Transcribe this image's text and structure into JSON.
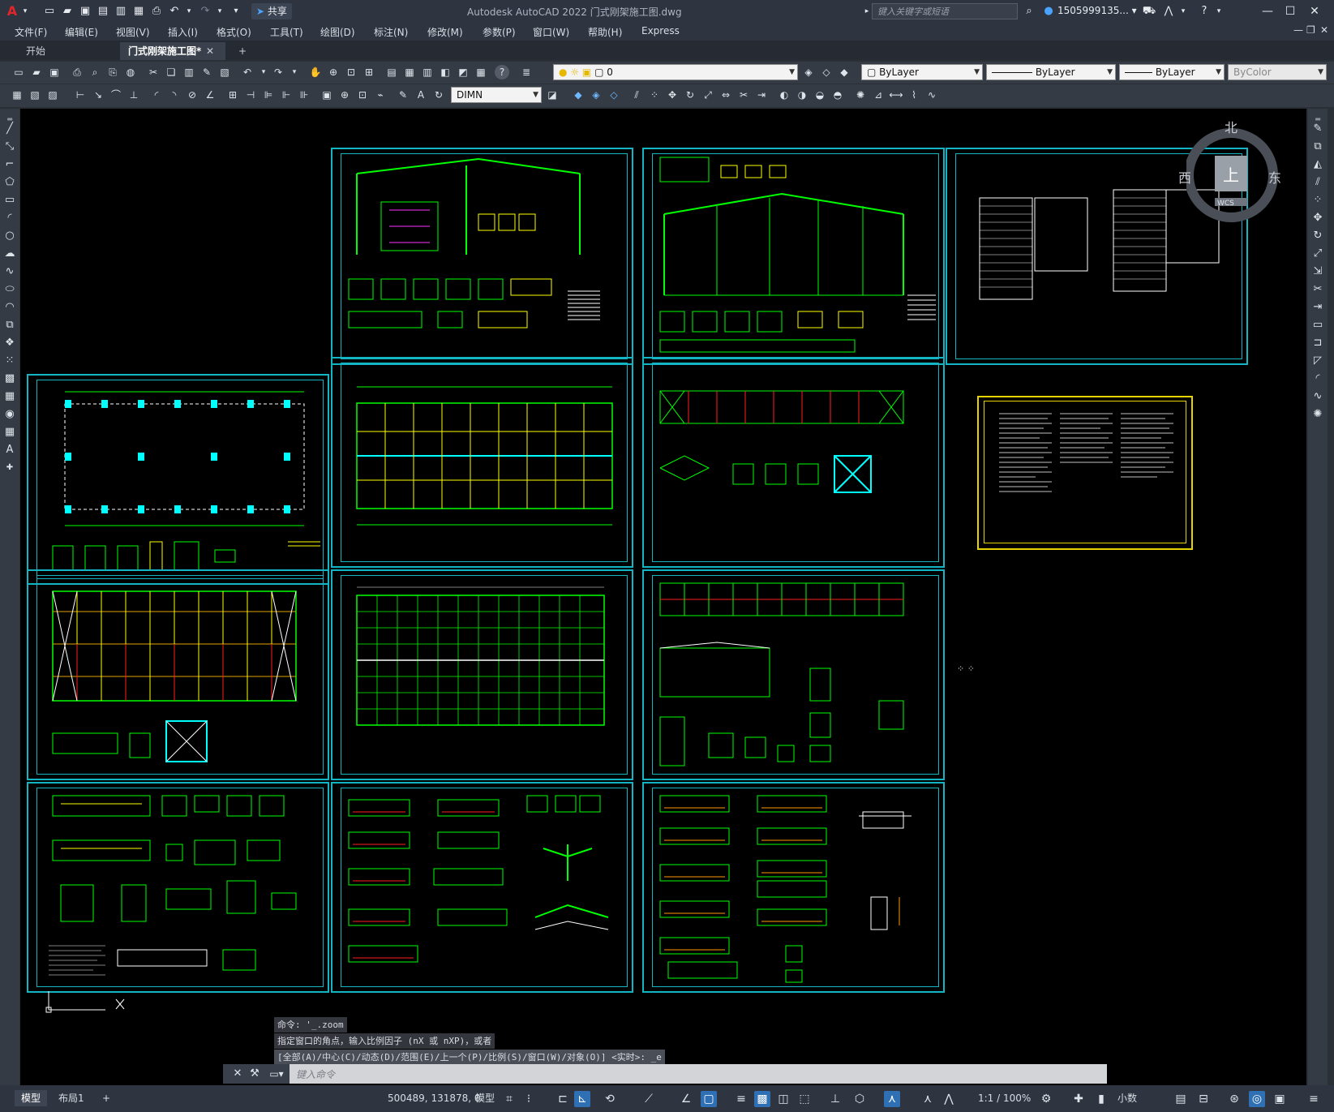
{
  "app": {
    "title": "Autodesk AutoCAD 2022    门式刚架施工图.dwg",
    "logo": "A",
    "share_label": "共享",
    "search_placeholder": "键入关键字或短语",
    "user": "1505999135... ▾"
  },
  "menu": [
    "文件(F)",
    "编辑(E)",
    "视图(V)",
    "插入(I)",
    "格式(O)",
    "工具(T)",
    "绘图(D)",
    "标注(N)",
    "修改(M)",
    "参数(P)",
    "窗口(W)",
    "帮助(H)",
    "Express"
  ],
  "tabs": {
    "start": "开始",
    "drawing": "门式刚架施工图*",
    "add": "+"
  },
  "toolbar": {
    "layer_value": "0",
    "color_value": "ByLayer",
    "linetype_value": "ByLayer",
    "lineweight_value": "ByLayer",
    "plotstyle_value": "ByColor",
    "dimstyle_value": "DIMN"
  },
  "compass": {
    "north": "北",
    "west": "西",
    "east": "东",
    "top": "上",
    "wcs": "WCS"
  },
  "command": {
    "history": [
      "命令: '_.zoom",
      "指定窗口的角点，输入比例因子 (nX 或 nXP)，或者",
      "[全部(A)/中心(C)/动态(D)/范围(E)/上一个(P)/比例(S)/窗口(W)/对象(O)] <实时>: _e"
    ],
    "placeholder": "键入命令"
  },
  "status": {
    "tab_model": "模型",
    "tab_layout": "布局1",
    "tab_add": "+",
    "coords": "500489, 131878, 0",
    "model_label": "模型",
    "scale": "1:1 / 100%",
    "units": "小数"
  },
  "colors": {
    "sheet_border": "#13b5c4",
    "drawing_green": "#00ff00",
    "highlight_yellow": "#ffff00",
    "accent_red": "#ff2020"
  }
}
